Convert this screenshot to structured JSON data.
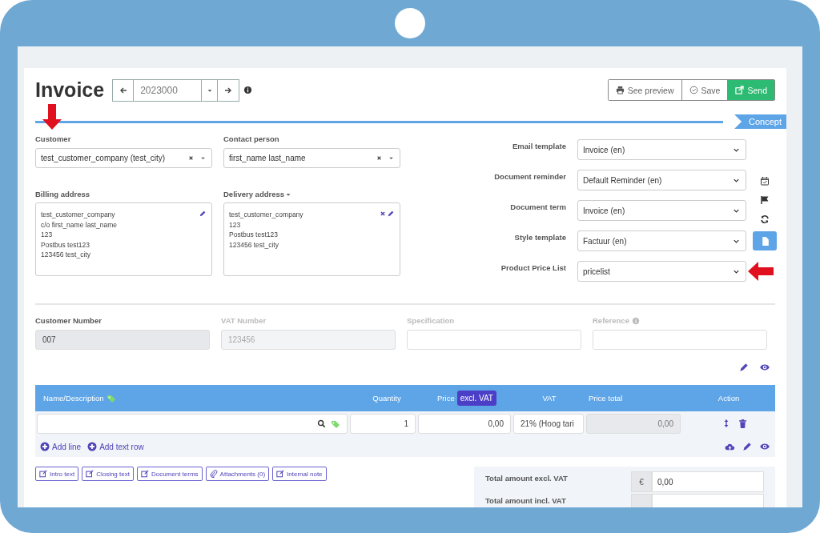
{
  "header": {
    "title": "Invoice",
    "number": "2023000"
  },
  "actions": [
    {
      "label": "See preview",
      "kind": "default"
    },
    {
      "label": "Save",
      "kind": "default"
    },
    {
      "label": "Send",
      "kind": "primary"
    }
  ],
  "status": "Concept",
  "customer": {
    "label": "Customer",
    "value": "test_customer_company (test_city)",
    "annotated": true
  },
  "contact": {
    "label": "Contact person",
    "value": "first_name last_name"
  },
  "billing": {
    "label": "Billing address",
    "lines": [
      "test_customer_company",
      "c/o first_name last_name",
      "123",
      "Postbus test123",
      "123456 test_city"
    ]
  },
  "delivery": {
    "label": "Delivery address",
    "lines": [
      "test_customer_company",
      "123",
      "Postbus test123",
      "123456 test_city"
    ]
  },
  "settings": [
    {
      "label": "Email template",
      "value": "Invoice (en)"
    },
    {
      "label": "Document reminder",
      "value": "Default Reminder (en)"
    },
    {
      "label": "Document term",
      "value": "Invoice (en)"
    },
    {
      "label": "Style template",
      "value": "Factuur (en)"
    },
    {
      "label": "Product Price List",
      "value": "pricelist",
      "annotated": true
    }
  ],
  "side_tools": [
    {
      "selected": false
    },
    {
      "selected": false
    },
    {
      "selected": false
    },
    {
      "selected": true
    }
  ],
  "fields": [
    {
      "label": "Customer Number",
      "value": "007",
      "kind": "readonly"
    },
    {
      "label": "VAT Number",
      "value": "123456",
      "kind": "disabled"
    },
    {
      "label": "Specification",
      "kind": "disabled"
    },
    {
      "label": "Reference",
      "kind": "disabled",
      "info": true
    }
  ],
  "table": {
    "columns": [
      {
        "label": "Name/Description",
        "tag": true
      },
      {
        "label": "Quantity"
      },
      {
        "label": "Price",
        "badge": "excl. VAT"
      },
      {
        "label": "VAT"
      },
      {
        "label": "Price total"
      },
      {
        "label": "Action"
      }
    ],
    "rows": [
      {
        "quantity": "1",
        "price": "0,00",
        "vat": "21% (Hoog tari",
        "total": "0,00"
      }
    ],
    "add_buttons": [
      "Add line",
      "Add text row"
    ]
  },
  "text_buttons": [
    {
      "label": "Intro text",
      "kind": "text"
    },
    {
      "label": "Closing text",
      "kind": "text"
    },
    {
      "label": "Document terms",
      "kind": "text"
    },
    {
      "label": "Attachments (0)",
      "kind": "attachments"
    },
    {
      "label": "Internal note",
      "kind": "text"
    }
  ],
  "totals": [
    {
      "label": "Total amount excl. VAT",
      "currency": "€",
      "value": "0,00"
    },
    {
      "label": "Total amount incl. VAT"
    }
  ]
}
